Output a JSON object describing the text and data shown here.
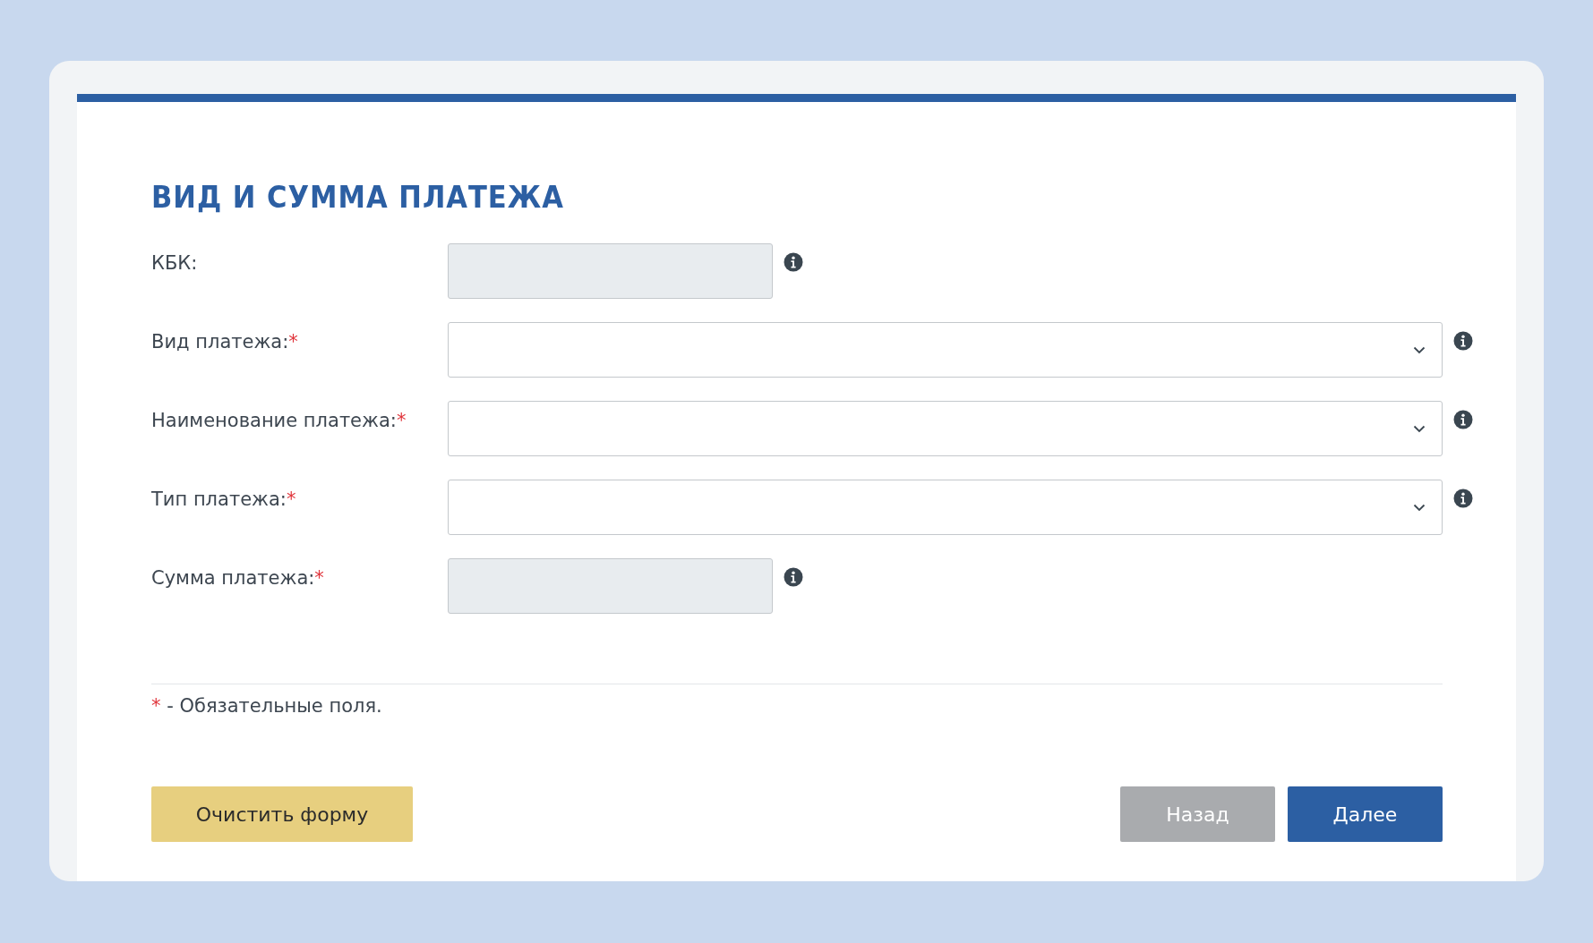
{
  "form": {
    "title": "ВИД И СУММА ПЛАТЕЖА",
    "fields": [
      {
        "label": "КБК:",
        "required": false,
        "kind": "text",
        "disabled": true
      },
      {
        "label": "Вид платежа:",
        "required": true,
        "kind": "select",
        "disabled": false
      },
      {
        "label": "Наименование платежа:",
        "required": true,
        "kind": "select",
        "disabled": false
      },
      {
        "label": "Тип платежа:",
        "required": true,
        "kind": "select",
        "disabled": false
      },
      {
        "label": "Сумма платежа:",
        "required": true,
        "kind": "text",
        "disabled": true
      }
    ],
    "required_mark": "*",
    "note": {
      "mark": "*",
      "text": "- Обязательные поля."
    },
    "buttons": [
      {
        "label": "Очистить форму",
        "kind": "clear",
        "disabled": false
      },
      {
        "label": "Назад",
        "kind": "back",
        "disabled": true
      },
      {
        "label": "Далее",
        "kind": "next",
        "disabled": false
      }
    ]
  }
}
